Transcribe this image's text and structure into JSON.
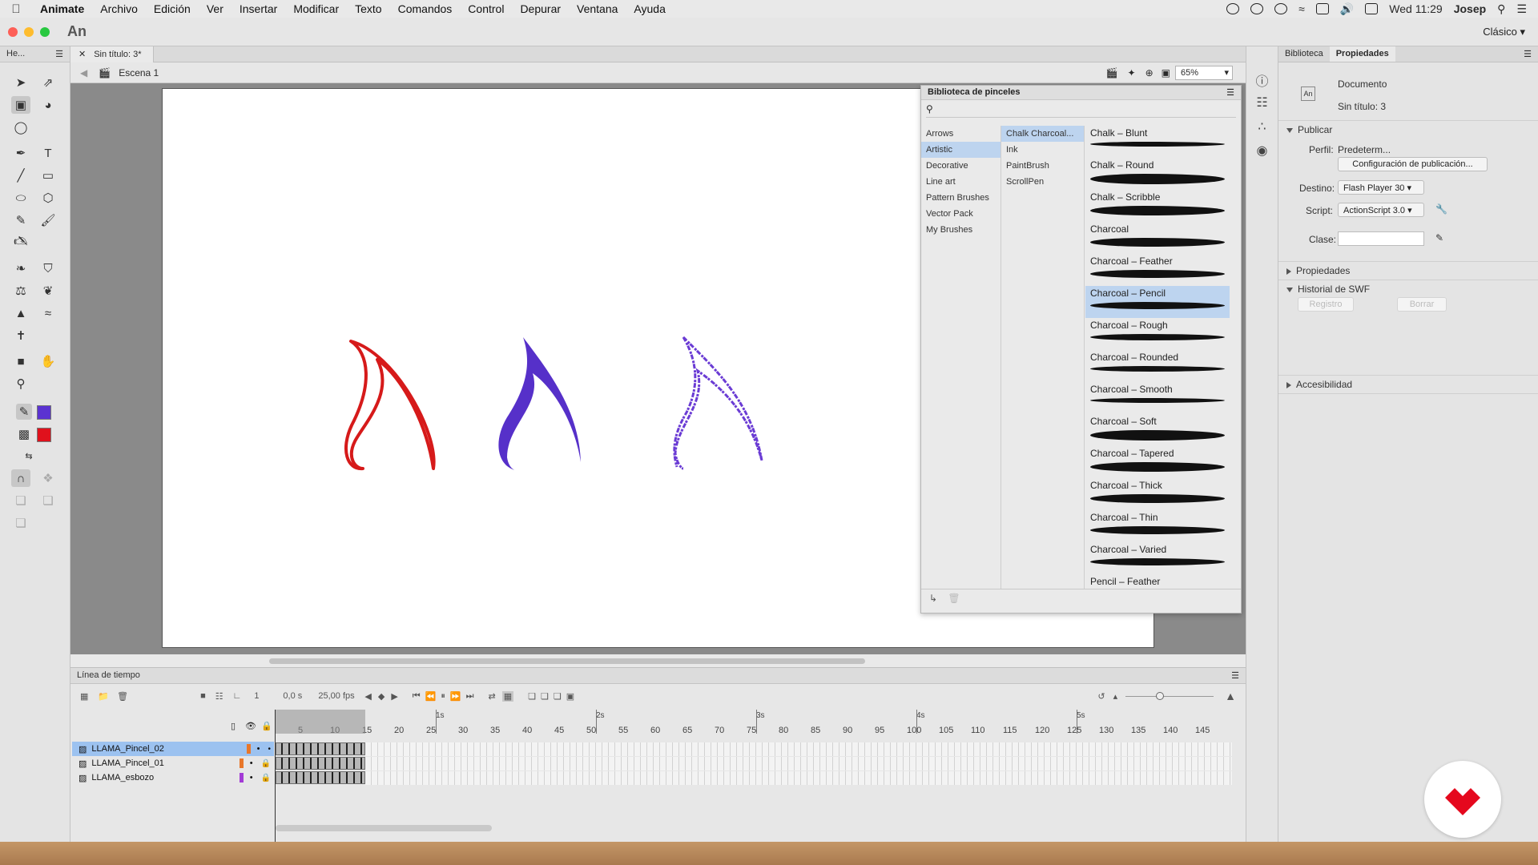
{
  "menubar": {
    "items": [
      "Animate",
      "Archivo",
      "Edición",
      "Ver",
      "Insertar",
      "Modificar",
      "Texto",
      "Comandos",
      "Control",
      "Depurar",
      "Ventana",
      "Ayuda"
    ],
    "clock": "Wed 11:29",
    "user": "Josep"
  },
  "titlebar": {
    "logo": "An",
    "workspace": "Clásico"
  },
  "toolpanel": {
    "header": "He...",
    "stroke_color": "#5b33d1",
    "fill_color": "#e0111c"
  },
  "document": {
    "tab_title": "Sin título: 3*",
    "scene": "Escena 1",
    "zoom": "65%"
  },
  "canvas": {
    "flames": [
      {
        "color": "#d61a1a",
        "style": "outline"
      },
      {
        "color": "#5630c9",
        "style": "filled"
      },
      {
        "color": "#6a3bd4",
        "style": "charcoal"
      }
    ]
  },
  "brush_library": {
    "title": "Biblioteca de pinceles",
    "categories": [
      "Arrows",
      "Artistic",
      "Decorative",
      "Line art",
      "Pattern Brushes",
      "Vector Pack",
      "My Brushes"
    ],
    "selected_category": "Artistic",
    "subcategories": [
      "Chalk Charcoal...",
      "Ink",
      "PaintBrush",
      "ScrollPen"
    ],
    "selected_subcategory": "Chalk Charcoal...",
    "brushes": [
      "Chalk – Blunt",
      "Chalk – Round",
      "Chalk – Scribble",
      "Charcoal",
      "Charcoal – Feather",
      "Charcoal – Pencil",
      "Charcoal – Rough",
      "Charcoal – Rounded",
      "Charcoal – Smooth",
      "Charcoal – Soft",
      "Charcoal – Tapered",
      "Charcoal – Thick",
      "Charcoal – Thin",
      "Charcoal – Varied",
      "Pencil – Feather"
    ],
    "selected_brush": "Charcoal – Pencil"
  },
  "properties": {
    "tabs": [
      "Biblioteca",
      "Propiedades"
    ],
    "active_tab": "Propiedades",
    "doc_type": "Documento",
    "doc_name": "Sin título: 3",
    "publish_section": "Publicar",
    "profile_label": "Perfil:",
    "profile_value": "Predeterm...",
    "publish_settings_button": "Configuración de publicación...",
    "target_label": "Destino:",
    "target_value": "Flash Player 30",
    "script_label": "Script:",
    "script_value": "ActionScript 3.0",
    "class_label": "Clase:",
    "class_value": "",
    "properties_section": "Propiedades",
    "swf_history_section": "Historial de SWF",
    "log_button": "Registro",
    "clear_button": "Borrar",
    "accessibility_section": "Accesibilidad"
  },
  "timeline": {
    "title": "Línea de tiempo",
    "current_frame": "1",
    "time": "0,0 s",
    "fps": "25,00 fps",
    "frame_ticks": [
      "5",
      "10",
      "15",
      "20",
      "25",
      "30",
      "35",
      "40",
      "45",
      "50",
      "55",
      "60",
      "65",
      "70",
      "75",
      "80",
      "85",
      "90",
      "95",
      "100",
      "105",
      "110",
      "115",
      "120",
      "125",
      "130",
      "135",
      "140",
      "145"
    ],
    "second_markers": [
      "1s",
      "2s",
      "3s",
      "4s",
      "5s"
    ],
    "layers": [
      {
        "name": "LLAMA_Pincel_02",
        "tag_color": "#e8772a",
        "selected": true
      },
      {
        "name": "LLAMA_Pincel_01",
        "tag_color": "#e8772a",
        "selected": false
      },
      {
        "name": "LLAMA_esbozo",
        "tag_color": "#a33bd6",
        "selected": false
      }
    ]
  }
}
